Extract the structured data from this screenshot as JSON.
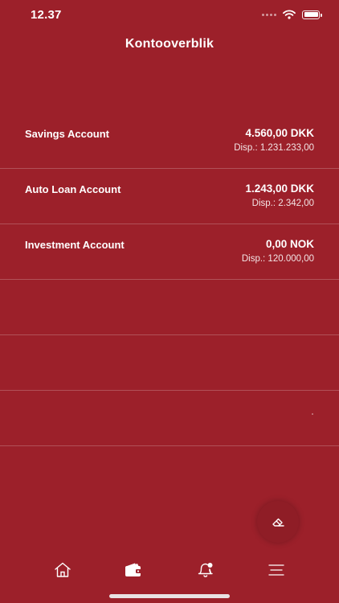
{
  "status_bar": {
    "time": "12.37"
  },
  "header": {
    "title": "Kontooverblik"
  },
  "accounts": [
    {
      "name": "Savings Account",
      "balance": "4.560,00 DKK",
      "available": "Disp.: 1.231.233,00"
    },
    {
      "name": "Auto Loan Account",
      "balance": "1.243,00 DKK",
      "available": "Disp.: 2.342,00"
    },
    {
      "name": "Investment Account",
      "balance": "0,00 NOK",
      "available": "Disp.: 120.000,00"
    }
  ],
  "tab_bar": {
    "tabs": [
      {
        "icon": "home-icon"
      },
      {
        "icon": "wallet-icon"
      },
      {
        "icon": "bell-icon"
      },
      {
        "icon": "menu-icon"
      }
    ]
  },
  "colors": {
    "background": "#9c202a",
    "text": "#ffffff",
    "fab_background": "#8f1d26"
  }
}
